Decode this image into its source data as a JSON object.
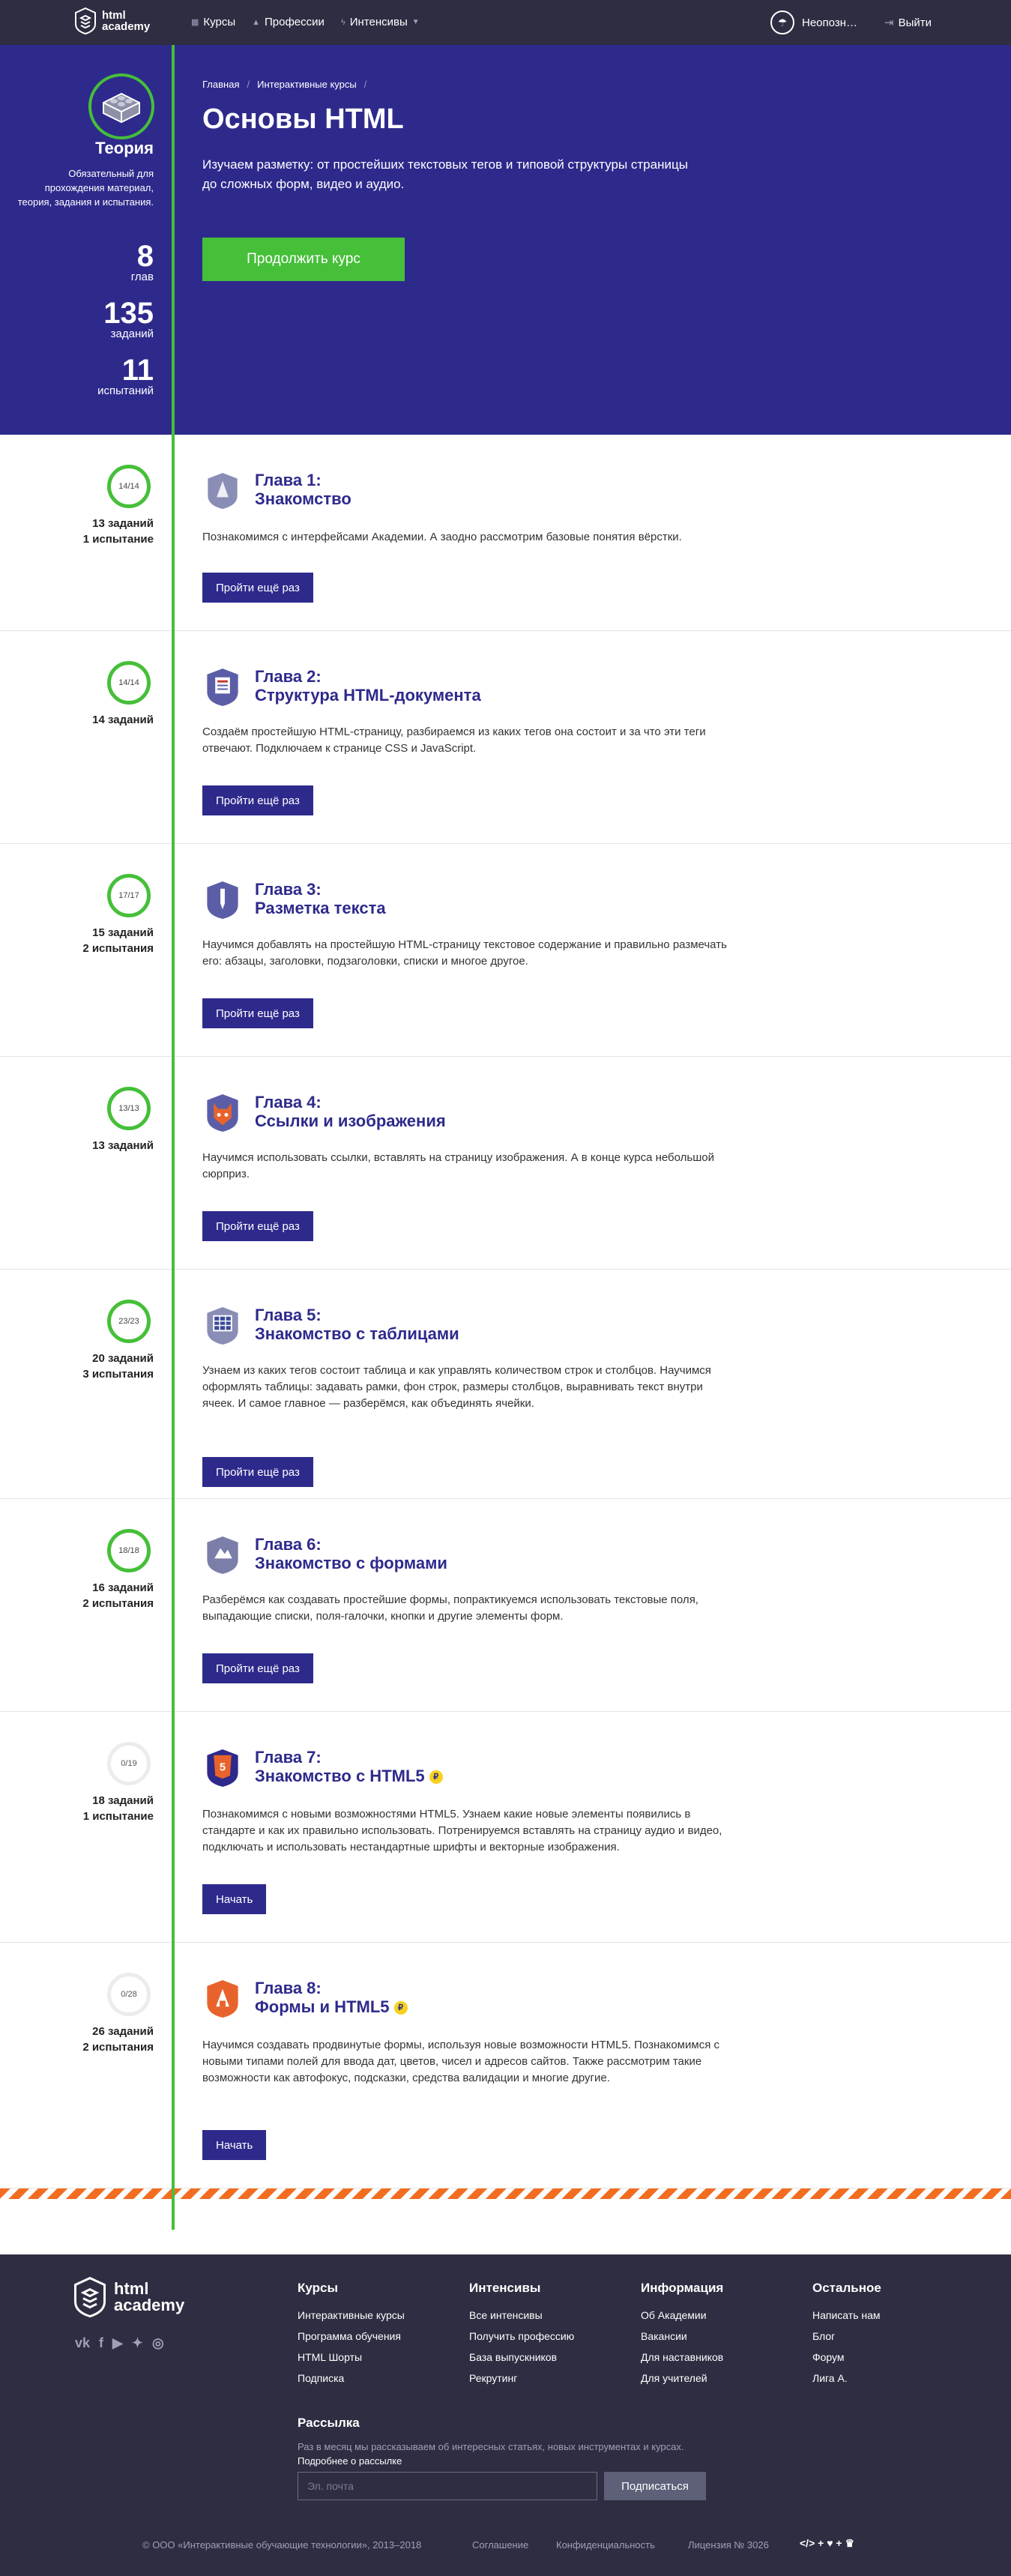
{
  "header": {
    "logo_line1": "html",
    "logo_line2": "academy",
    "nav": [
      {
        "icon": "grid-icon",
        "label": "Курсы"
      },
      {
        "icon": "graduation-icon",
        "label": "Профессии"
      },
      {
        "icon": "lightning-icon",
        "label": "Интенсивы"
      }
    ],
    "user_name": "Неопозн…",
    "logout": "Выйти"
  },
  "hero": {
    "breadcrumbs": [
      "Главная",
      "Интерактивные курсы"
    ],
    "title": "Основы HTML",
    "lead": "Изучаем разметку: от простейших текстовых тегов и типовой структуры страницы до сложных форм, видео и аудио.",
    "cta": "Продолжить курс",
    "theory_title": "Теория",
    "theory_desc": "Обязательный для прохождения материал, теория, задания и испытания.",
    "stats": [
      {
        "num": "8",
        "label": "глав"
      },
      {
        "num": "135",
        "label": "заданий"
      },
      {
        "num": "11",
        "label": "испытаний"
      }
    ]
  },
  "chapters": [
    {
      "progress": "14/14",
      "tasks": "13 заданий",
      "tests": "1 испытание",
      "title1": "Глава 1:",
      "title2": "Знакомство",
      "paid": false,
      "desc": "Познакомимся с интерфейсами Академии. А заодно рассмотрим базовые понятия вёрстки.",
      "button": "Пройти ещё раз",
      "icon_color": "#8a8db5"
    },
    {
      "progress": "14/14",
      "tasks": "14 заданий",
      "tests": "",
      "title1": "Глава 2:",
      "title2": "Структура HTML-документа",
      "paid": false,
      "desc": "Создаём простейшую HTML-страницу, разбираемся из каких тегов она состоит и за что эти теги отвечают. Подключаем к странице CSS и JavaScript.",
      "button": "Пройти ещё раз",
      "icon_color": "#c0392b"
    },
    {
      "progress": "17/17",
      "tasks": "15 заданий",
      "tests": "2 испытания",
      "title1": "Глава 3:",
      "title2": "Разметка текста",
      "paid": false,
      "desc": "Научимся добавлять на простейшую HTML-страницу текстовое содержание и правильно размечать его: абзацы, заголовки, подзаголовки, списки и многое другое.",
      "button": "Пройти ещё раз",
      "icon_color": "#5b5ea6"
    },
    {
      "progress": "13/13",
      "tasks": "13 заданий",
      "tests": "",
      "title1": "Глава 4:",
      "title2": "Ссылки и изображения",
      "paid": false,
      "desc": "Научимся использовать ссылки, вставлять на страницу изображения. А в конце курса небольшой сюрприз.",
      "button": "Пройти ещё раз",
      "icon_color": "#e8632b"
    },
    {
      "progress": "23/23",
      "tasks": "20 заданий",
      "tests": "3 испытания",
      "title1": "Глава 5:",
      "title2": "Знакомство с таблицами",
      "paid": false,
      "desc": "Узнаем из каких тегов состоит таблица и как управлять количеством строк и столбцов. Научимся оформлять таблицы: задавать рамки, фон строк, размеры столбцов, выравнивать текст внутри ячеек. И самое главное — разберёмся, как объединять ячейки.",
      "button": "Пройти ещё раз",
      "icon_color": "#3b4a9a"
    },
    {
      "progress": "18/18",
      "tasks": "16 заданий",
      "tests": "2 испытания",
      "title1": "Глава 6:",
      "title2": "Знакомство с формами",
      "paid": false,
      "desc": "Разберёмся как создавать простейшие формы, попрактикуемся использовать текстовые поля, выпадающие списки, поля-галочки, кнопки и другие элементы форм.",
      "button": "Пройти ещё раз",
      "icon_color": "#7b7ea8"
    },
    {
      "progress": "0/19",
      "tasks": "18 заданий",
      "tests": "1 испытание",
      "title1": "Глава 7:",
      "title2": "Знакомство с HTML5",
      "paid": true,
      "desc": "Познакомимся с новыми возможностями HTML5. Узнаем какие новые элементы появились в стандарте и как их правильно использовать. Потренируемся вставлять на страницу аудио и видео, подключать и использовать нестандартные шрифты и векторные изображения.",
      "button": "Начать",
      "icon_color": "#e8632b"
    },
    {
      "progress": "0/28",
      "tasks": "26 заданий",
      "tests": "2 испытания",
      "title1": "Глава 8:",
      "title2": "Формы и HTML5",
      "paid": true,
      "desc": "Научимся создавать продвинутые формы, используя новые возможности HTML5. Познакомимся с новыми типами полей для ввода дат, цветов, чисел и адресов сайтов. Также рассмотрим такие возможности как автофокус, подсказки, средства валидации и многие другие.",
      "button": "Начать",
      "icon_color": "#e8632b"
    }
  ],
  "paid_badge": "₽",
  "footer": {
    "logo_line1": "html",
    "logo_line2": "academy",
    "socials": [
      "vk-icon",
      "facebook-icon",
      "youtube-icon",
      "twitter-icon",
      "instagram-icon"
    ],
    "columns": [
      {
        "title": "Курсы",
        "links": [
          "Интерактивные курсы",
          "Программа обучения",
          "HTML Шорты",
          "Подписка"
        ]
      },
      {
        "title": "Интенсивы",
        "links": [
          "Все интенсивы",
          "Получить профессию",
          "База выпускников",
          "Рекрутинг"
        ]
      },
      {
        "title": "Информация",
        "links": [
          "Об Академии",
          "Вакансии",
          "Для наставников",
          "Для учителей"
        ]
      },
      {
        "title": "Остальное",
        "links": [
          "Написать нам",
          "Блог",
          "Форум",
          "Лига А."
        ]
      }
    ],
    "subscribe_title": "Рассылка",
    "subscribe_text": "Раз в месяц мы рассказываем об интересных статьях, новых инструментах и курсах.",
    "subscribe_link": "Подробнее о рассылке",
    "email_placeholder": "Эл. почта",
    "subscribe_button": "Подписаться",
    "copyright": "© ООО «Интерактивные обучающие технологии», 2013–2018",
    "agreement": "Соглашение",
    "privacy": "Конфиденциальность",
    "license": "Лицензия № 3026",
    "made_with": "</> + ♥ + ♛"
  }
}
